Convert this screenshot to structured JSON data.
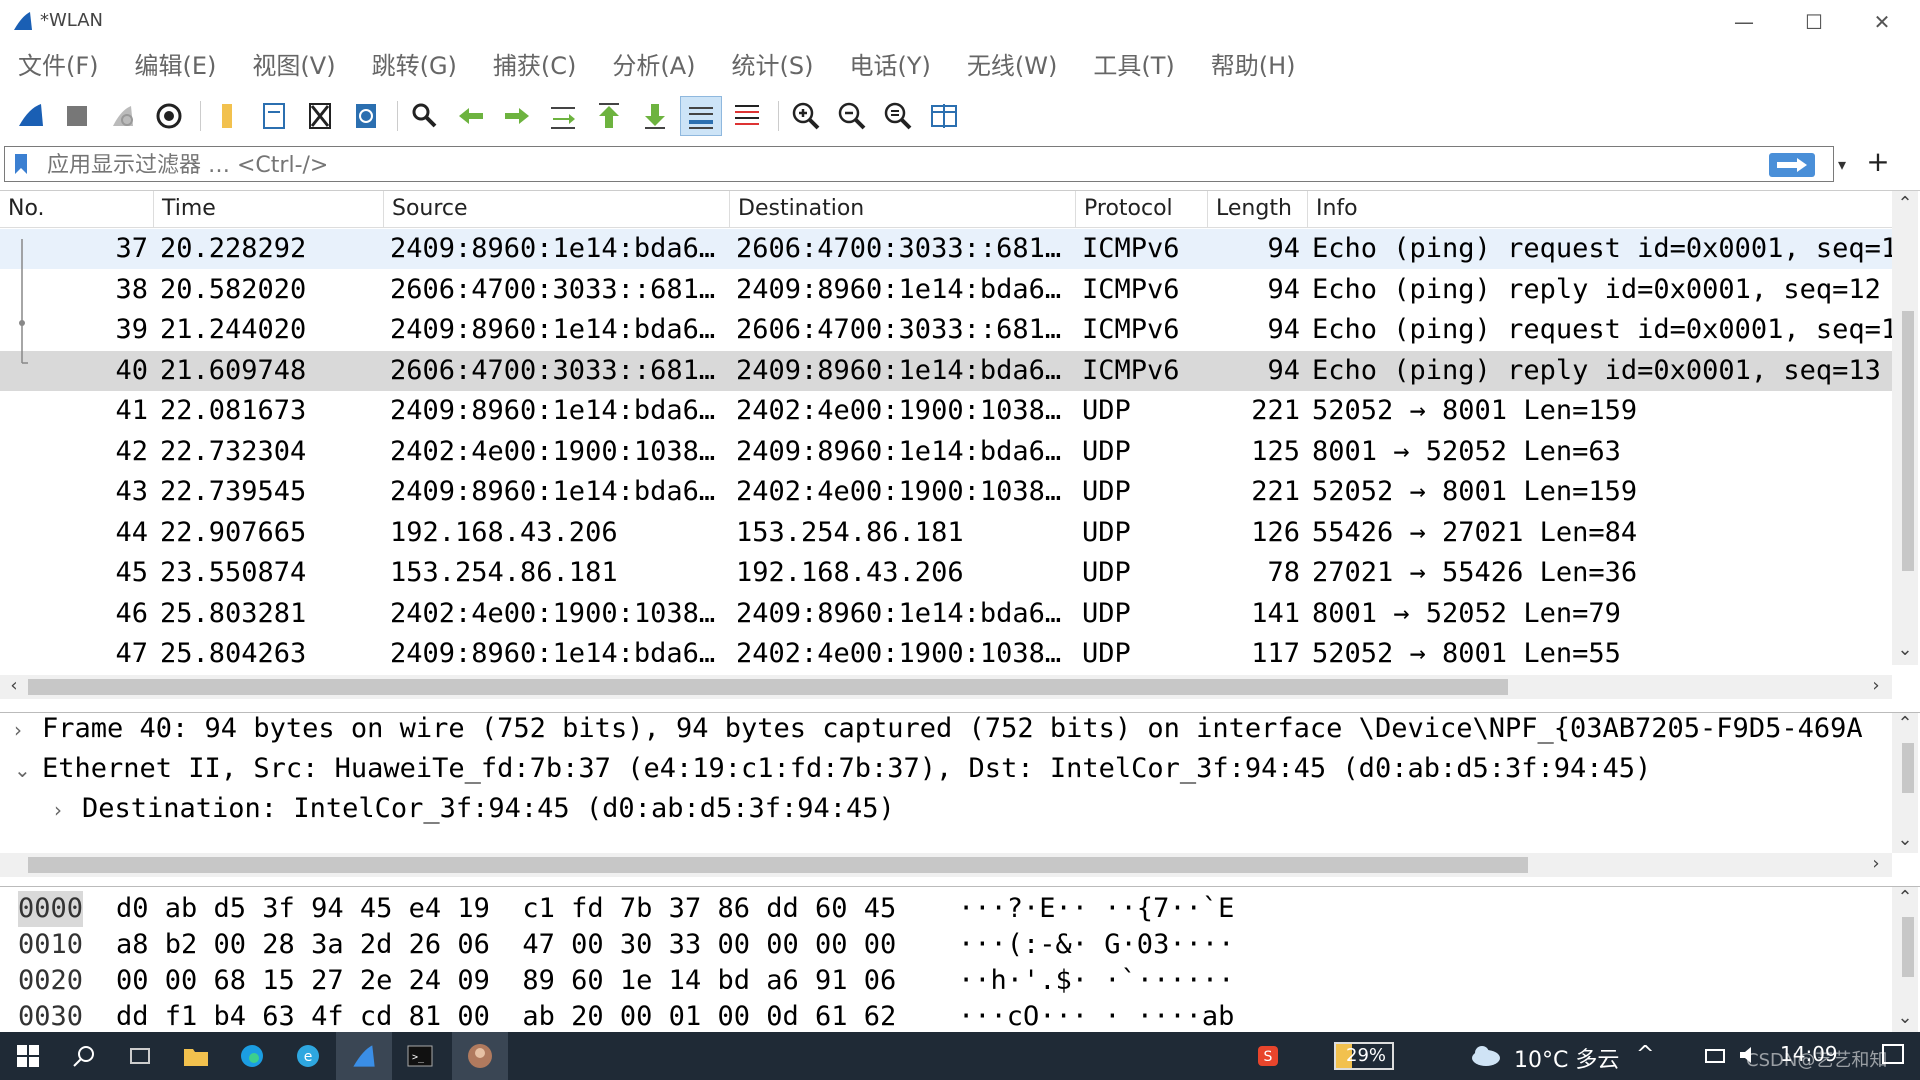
{
  "window": {
    "title": "*WLAN",
    "minimize_glyph": "—",
    "maximize_glyph": "☐",
    "close_glyph": "✕"
  },
  "menu": [
    "文件(F)",
    "编辑(E)",
    "视图(V)",
    "跳转(G)",
    "捕获(C)",
    "分析(A)",
    "统计(S)",
    "电话(Y)",
    "无线(W)",
    "工具(T)",
    "帮助(H)"
  ],
  "toolbar_icons": [
    "start-capture-icon",
    "stop-capture-icon",
    "restart-capture-icon",
    "capture-options-icon",
    "open-file-icon",
    "save-file-icon",
    "close-file-icon",
    "reload-file-icon",
    "find-packet-icon",
    "go-back-icon",
    "go-forward-icon",
    "go-to-packet-icon",
    "first-packet-icon",
    "last-packet-icon",
    "auto-scroll-icon",
    "colorize-icon",
    "zoom-in-icon",
    "zoom-out-icon",
    "normal-size-icon",
    "resize-columns-icon"
  ],
  "filter": {
    "placeholder": "应用显示过滤器 … <Ctrl-/>",
    "dropdown_glyph": "▾",
    "add_glyph": "+"
  },
  "packet_list": {
    "columns": [
      "No.",
      "Time",
      "Source",
      "Destination",
      "Protocol",
      "Length",
      "Info"
    ],
    "rows": [
      {
        "no": "37",
        "time": "20.228292",
        "src": "2409:8960:1e14:bda6…",
        "dst": "2606:4700:3033::681…",
        "proto": "ICMPv6",
        "len": "94",
        "info": "Echo (ping) request id=0x0001, seq=1"
      },
      {
        "no": "38",
        "time": "20.582020",
        "src": "2606:4700:3033::681…",
        "dst": "2409:8960:1e14:bda6…",
        "proto": "ICMPv6",
        "len": "94",
        "info": "Echo (ping) reply id=0x0001, seq=12"
      },
      {
        "no": "39",
        "time": "21.244020",
        "src": "2409:8960:1e14:bda6…",
        "dst": "2606:4700:3033::681…",
        "proto": "ICMPv6",
        "len": "94",
        "info": "Echo (ping) request id=0x0001, seq=1"
      },
      {
        "no": "40",
        "time": "21.609748",
        "src": "2606:4700:3033::681…",
        "dst": "2409:8960:1e14:bda6…",
        "proto": "ICMPv6",
        "len": "94",
        "info": "Echo (ping) reply id=0x0001, seq=13"
      },
      {
        "no": "41",
        "time": "22.081673",
        "src": "2409:8960:1e14:bda6…",
        "dst": "2402:4e00:1900:1038…",
        "proto": "UDP",
        "len": "221",
        "info": "52052 → 8001 Len=159"
      },
      {
        "no": "42",
        "time": "22.732304",
        "src": "2402:4e00:1900:1038…",
        "dst": "2409:8960:1e14:bda6…",
        "proto": "UDP",
        "len": "125",
        "info": "8001 → 52052 Len=63"
      },
      {
        "no": "43",
        "time": "22.739545",
        "src": "2409:8960:1e14:bda6…",
        "dst": "2402:4e00:1900:1038…",
        "proto": "UDP",
        "len": "221",
        "info": "52052 → 8001 Len=159"
      },
      {
        "no": "44",
        "time": "22.907665",
        "src": "192.168.43.206",
        "dst": "153.254.86.181",
        "proto": "UDP",
        "len": "126",
        "info": "55426 → 27021 Len=84"
      },
      {
        "no": "45",
        "time": "23.550874",
        "src": "153.254.86.181",
        "dst": "192.168.43.206",
        "proto": "UDP",
        "len": "78",
        "info": "27021 → 55426 Len=36"
      },
      {
        "no": "46",
        "time": "25.803281",
        "src": "2402:4e00:1900:1038…",
        "dst": "2409:8960:1e14:bda6…",
        "proto": "UDP",
        "len": "141",
        "info": "8001 → 52052 Len=79"
      },
      {
        "no": "47",
        "time": "25.804263",
        "src": "2409:8960:1e14:bda6…",
        "dst": "2402:4e00:1900:1038…",
        "proto": "UDP",
        "len": "117",
        "info": "52052 → 8001 Len=55"
      }
    ]
  },
  "details": [
    {
      "expander": "›",
      "text": "Frame 40: 94 bytes on wire (752 bits), 94 bytes captured (752 bits) on interface \\Device\\NPF_{03AB7205-F9D5-469A"
    },
    {
      "expander": "⌄",
      "text": "Ethernet II, Src: HuaweiTe_fd:7b:37 (e4:19:c1:fd:7b:37), Dst: IntelCor_3f:94:45 (d0:ab:d5:3f:94:45)"
    },
    {
      "expander": "›",
      "text": "Destination: IntelCor_3f:94:45 (d0:ab:d5:3f:94:45)"
    }
  ],
  "hex": [
    {
      "offset": "0000",
      "bytes": "d0 ab d5 3f 94 45 e4 19  c1 fd 7b 37 86 dd 60 45",
      "ascii": "···?·E·· ··{7··`E"
    },
    {
      "offset": "0010",
      "bytes": "a8 b2 00 28 3a 2d 26 06  47 00 30 33 00 00 00 00",
      "ascii": "···(:-&· G·03····"
    },
    {
      "offset": "0020",
      "bytes": "00 00 68 15 27 2e 24 09  89 60 1e 14 bd a6 91 06",
      "ascii": "··h·'.$· ·`······"
    },
    {
      "offset": "0030",
      "bytes": "dd f1 b4 63 4f cd 81 00  ab 20 00 01 00 0d 61 62",
      "ascii": "···cO··· · ····ab"
    }
  ],
  "taskbar": {
    "battery": "29%",
    "weather": "10°C 多云",
    "time": "14:09",
    "tray_up_glyph": "^",
    "watermark": "CSDN@艺艺和知"
  },
  "colors": {
    "row_highlight": "#e8f1fb",
    "row_selected": "#d9d9d9",
    "accent_blue": "#4a8fd8",
    "taskbar_bg": "#1f2a36"
  }
}
